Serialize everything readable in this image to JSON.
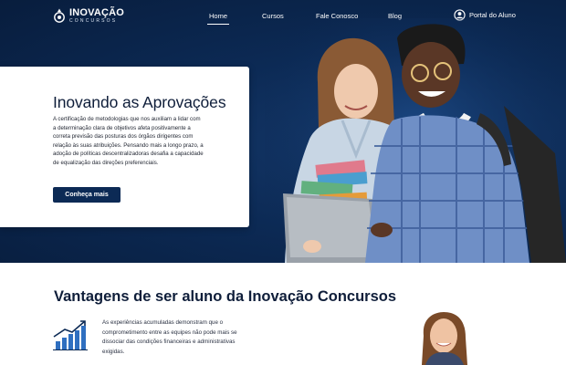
{
  "header": {
    "logo": {
      "name": "INOVAÇÃO",
      "subtitle": "CONCURSOS"
    },
    "menu": [
      {
        "label": "Home",
        "active": true
      },
      {
        "label": "Cursos",
        "active": false
      },
      {
        "label": "Fale Conosco",
        "active": false
      },
      {
        "label": "Blog",
        "active": false
      }
    ],
    "portal": {
      "label": "Portal do Aluno",
      "icon": "user-circle-icon"
    }
  },
  "hero": {
    "title": "Inovando as Aprovações",
    "text": "A certificação de metodologias que nos auxiliam a lidar com a determinação clara de objetivos afeta positivamente a correta previsão das posturas dos órgãos dirigentes com relação às suas atribuições. Pensando mais a longo prazo, a adoção de políticas descentralizadoras desafia a capacidade de equalização das direções preferenciais.",
    "cta_label": "Conheça mais",
    "image": "students-with-laptop-photo"
  },
  "advantages": {
    "title": "Vantagens de ser aluno da Inovação Concursos",
    "icon": "growth-chart-icon",
    "text": "As experiências acumuladas demonstram que o comprometimento entre as equipes não pode mais se dissociar das condições financeiras e administrativas exigidas.",
    "image": "smiling-student-photo"
  },
  "colors": {
    "primary": "#0c2a55",
    "hero_bg": "#0b2750",
    "accent_blue": "#2f6fc0",
    "text_dark": "#0f1e3a"
  }
}
